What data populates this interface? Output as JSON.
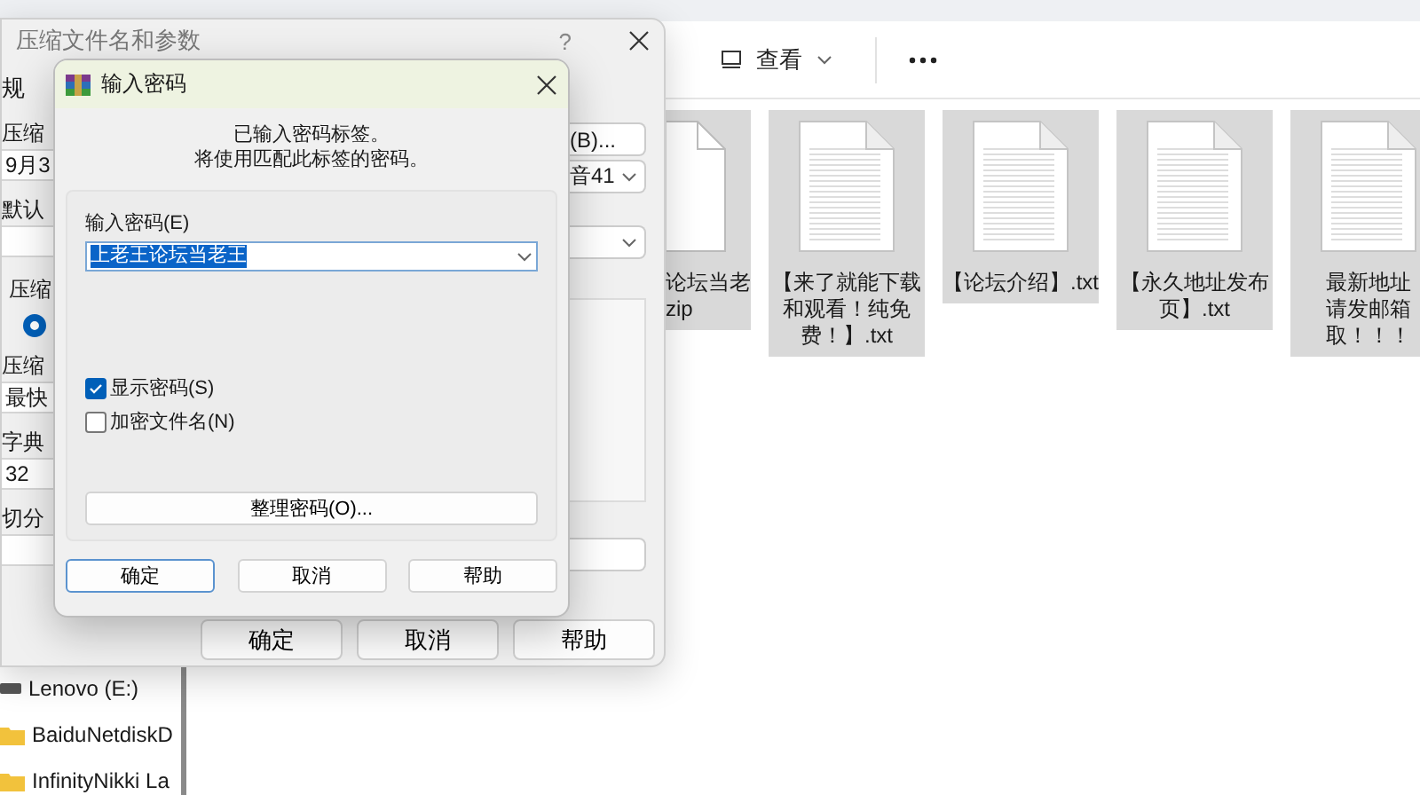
{
  "explorer": {
    "toolbar": {
      "view_label": "查看"
    },
    "files": [
      {
        "kind": "zip",
        "name_lines": [
          "论坛当老",
          "zip"
        ],
        "selected": true
      },
      {
        "kind": "txt",
        "name_lines": [
          "【来了就能下载",
          "和观看！纯免",
          "费！】.txt"
        ],
        "selected": true
      },
      {
        "kind": "txt",
        "name_lines": [
          "【论坛介绍】.txt"
        ],
        "selected": true
      },
      {
        "kind": "txt",
        "name_lines": [
          "【永久地址发布",
          "页】.txt"
        ],
        "selected": true
      },
      {
        "kind": "txt",
        "name_lines": [
          "最新地址",
          "请发邮箱",
          "取！！！"
        ],
        "selected": true
      }
    ],
    "sidebar": [
      {
        "kind": "drive",
        "label": "Lenovo (E:)"
      },
      {
        "kind": "folder",
        "label": "BaiduNetdiskD"
      },
      {
        "kind": "folder",
        "label": "InfinityNikki La"
      }
    ]
  },
  "archive_dialog": {
    "title": "压缩文件名和参数",
    "help": "?",
    "left_items": [
      {
        "kind": "tab",
        "text": "规"
      },
      {
        "kind": "label",
        "text": "压缩"
      },
      {
        "kind": "field",
        "text": "9月3"
      },
      {
        "kind": "label",
        "text": "默认"
      },
      {
        "kind": "field"
      },
      {
        "kind": "group",
        "text": "压缩"
      },
      {
        "kind": "radio",
        "selected": true
      },
      {
        "kind": "label",
        "text": "压缩"
      },
      {
        "kind": "field",
        "text": "最快"
      },
      {
        "kind": "label",
        "text": "字典"
      },
      {
        "kind": "field",
        "text": "32"
      },
      {
        "kind": "label",
        "text": "切分"
      },
      {
        "kind": "field"
      }
    ],
    "right_items": [
      {
        "kind": "button",
        "text": "(B)..."
      },
      {
        "kind": "dropdown",
        "text": "音41"
      },
      {
        "kind": "dropdown"
      },
      {
        "kind": "pane"
      },
      {
        "kind": "field"
      }
    ],
    "buttons": [
      "确定",
      "取消",
      "帮助"
    ]
  },
  "password_dialog": {
    "title": "输入密码",
    "message_lines": [
      "已输入密码标签。",
      "将使用匹配此标签的密码。"
    ],
    "password_label": "输入密码(E)",
    "password_value": "上老王论坛当老王",
    "checkboxes": [
      {
        "label": "显示密码(S)",
        "checked": true
      },
      {
        "label": "加密文件名(N)",
        "checked": false
      }
    ],
    "organize_button": "整理密码(O)...",
    "buttons": [
      {
        "label": "确定",
        "default": true
      },
      {
        "label": "取消",
        "default": false
      },
      {
        "label": "帮助",
        "default": false
      }
    ]
  }
}
